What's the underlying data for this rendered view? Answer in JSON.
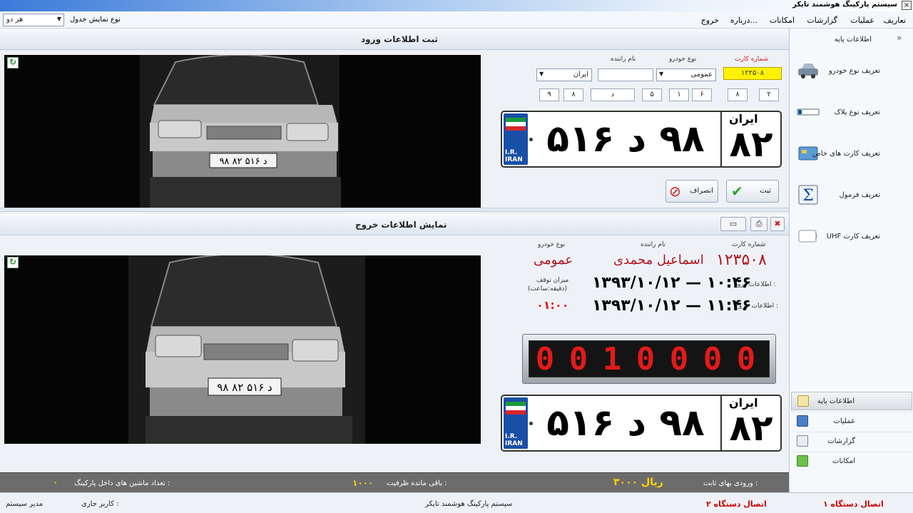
{
  "window": {
    "title": "سیستم پارکینگ هوشمند تایکر",
    "close_glyph": "×"
  },
  "menu": {
    "items": [
      "تعاریف",
      "عملیات",
      "گزارشات",
      "امکانات",
      "درباره...",
      "خروج"
    ],
    "table_view_label": "نوع نمایش جدول",
    "table_view_value": "هر دو"
  },
  "entry": {
    "header": "ثبت اطلاعات ورود",
    "labels": {
      "card": "شماره کارت",
      "vehicle_type": "نوع خودرو",
      "driver": "نام راننده"
    },
    "card_value": "۱۲۲۵۰۸",
    "vehicle_type_value": "عمومی",
    "driver_value": "",
    "country_value": "ایران",
    "plate_boxes": [
      "۲",
      "۸",
      "۶",
      "۱",
      "۵",
      "د",
      "۸",
      "۹"
    ],
    "plate": {
      "main": "۹۸ د ۵۱۶",
      "region": "۸۲",
      "country": "ایران",
      "iran_text": "I.R.\nIRAN"
    },
    "buttons": {
      "submit": "ثبت",
      "cancel": "انصراف"
    }
  },
  "exit": {
    "header": "نمایش اطلاعات خروج",
    "labels": {
      "card": "شماره کارت",
      "driver": "نام راننده",
      "vehicle_type": "نوع خودرو",
      "entry_info": "اطلاعات ورود :",
      "exit_info": "اطلاعات خروج :",
      "stay_amount": "میزان توقف",
      "stay_unit": "(دقیقه:ساعت)"
    },
    "card_value": "۱۲۳۵۰۸",
    "driver_value": "اسماعیل محمدی",
    "vehicle_type_value": "عمومی",
    "entry_datetime": "۱۳۹۳/۱۰/۱۲ — ۱۰:۴۶",
    "exit_datetime": "۱۳۹۳/۱۰/۱۲ — ۱۱:۴۶",
    "stay_value": "۰۱:۰۰",
    "led_digits": [
      "0",
      "0",
      "1",
      "0",
      "0",
      "0",
      "0"
    ],
    "plate": {
      "main": "۹۸ د ۵۱۶",
      "region": "۸۲",
      "country": "ایران",
      "iran_text": "I.R.\nIRAN"
    }
  },
  "footer": {
    "fixed_entry_label": "ورودی بهای ثابت :",
    "fixed_entry_value": "۳۰۰۰ ریال",
    "remaining_label": "باقی مانده ظرفیت :",
    "remaining_value": "۱۰۰۰",
    "cars_inside_label": "تعداد ماشین های داخل پارکینگ :",
    "cars_inside_value": "۰"
  },
  "sidebar": {
    "title": "اطلاعات پایه",
    "items": [
      {
        "label": "تعریف نوع خودرو",
        "icon": "car-icon"
      },
      {
        "label": "تعریف نوع پلاک",
        "icon": "plate-icon"
      },
      {
        "label": "تعریف کارت های خاص",
        "icon": "card-icon"
      },
      {
        "label": "تعریف فرمول",
        "icon": "sigma-icon"
      },
      {
        "label": "UHF تعریف کارت",
        "icon": "uhf-card-icon"
      }
    ],
    "nav": [
      {
        "label": "اطلاعات پایه",
        "icon": "edit-icon"
      },
      {
        "label": "عملیات",
        "icon": "monitor-icon"
      },
      {
        "label": "گزارشات",
        "icon": "report-icon"
      },
      {
        "label": "امکانات",
        "icon": "tools-icon"
      }
    ]
  },
  "status": {
    "device1": "اتصال دستگاه ۱",
    "device2": "اتصال دستگاه ۲",
    "app_name": "سیستم پارکینگ هوشمند تایکر",
    "current_user_label": "کاربر جاری :",
    "current_user": "مدیر سیستم"
  },
  "colors": {
    "accent_red": "#b0141e",
    "led_red": "#e21a1a",
    "card_yellow": "#fff200"
  }
}
